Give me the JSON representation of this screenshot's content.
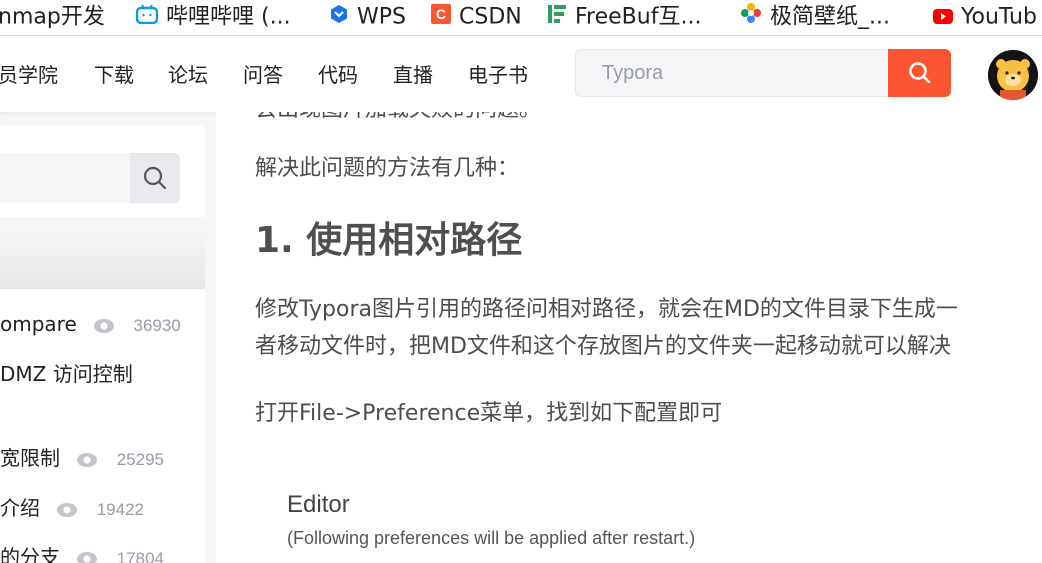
{
  "bookmarks": [
    {
      "label": "nmap开发",
      "icon": "folder-icon"
    },
    {
      "label": "哔哩哔哩 (...",
      "icon": "bilibili-icon"
    },
    {
      "label": "WPS",
      "icon": "wps-icon"
    },
    {
      "label": "CSDN",
      "icon": "csdn-icon"
    },
    {
      "label": "FreeBuf互...",
      "icon": "freebuf-icon"
    },
    {
      "label": "极简壁纸_...",
      "icon": "wallpaper-icon"
    },
    {
      "label": "YouTub",
      "icon": "youtube-icon"
    }
  ],
  "toolbar": {
    "nav": [
      "员学院",
      "下载",
      "论坛",
      "问答",
      "代码",
      "直播",
      "电子书"
    ],
    "search_value": "Typora",
    "search_icon": "search-icon",
    "avatar": "avatar-icon",
    "accent": "#fc5531"
  },
  "sidebar": {
    "search_icon": "search-icon",
    "articles": [
      {
        "title": "ompare",
        "views": "36930"
      },
      {
        "title": "DMZ 访问控制",
        "views": ""
      },
      {
        "title": "宽限制",
        "views": "25295"
      },
      {
        "title": "介绍",
        "views": "19422"
      },
      {
        "title": "的分支",
        "views": "17804"
      }
    ]
  },
  "article": {
    "top_partial": "会出现图片加载失败的问题。",
    "para1": "解决此问题的方法有几种：",
    "heading": "1. 使用相对路径",
    "para2_line1": "修改Typora图片引用的路径问相对路径，就会在MD的文件目录下生成一",
    "para2_line2": "者移动文件时，把MD文件和这个存放图片的文件夹一起移动就可以解决",
    "para3": "打开File->Preference菜单，找到如下配置即可",
    "screenshot": {
      "title": "Editor",
      "subtitle": "(Following preferences will be applied after restart.)"
    }
  }
}
